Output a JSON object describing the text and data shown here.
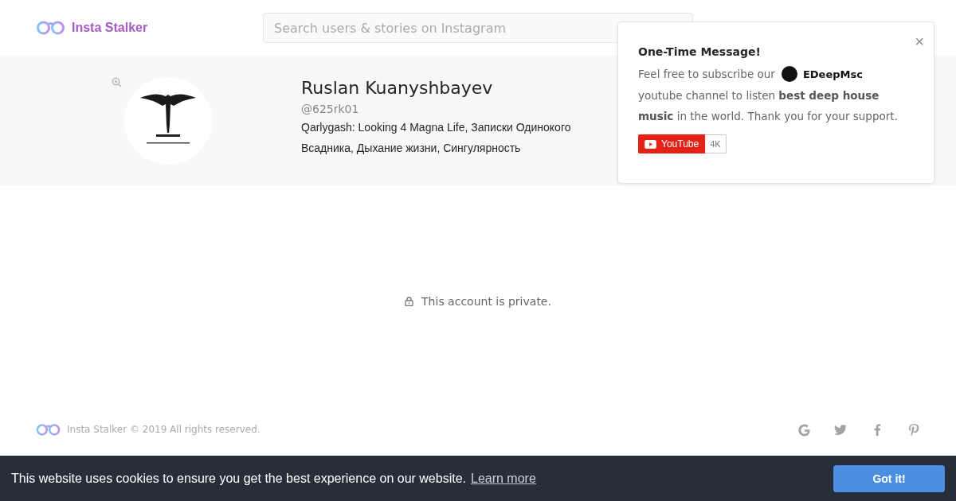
{
  "header": {
    "brand": "Insta Stalker",
    "search": {
      "placeholder": "Search users & stories on Instagram"
    }
  },
  "profile": {
    "name": "Ruslan Kuanyshbayev",
    "username": "@625rk01",
    "bio": "Qarlygash: Looking 4 Magna Life, Записки Одинокого Всадника, Дыхание жизни, Сингулярность"
  },
  "popup": {
    "title": "One-Time Message!",
    "close": "×",
    "text_before": "Feel free to subscribe our",
    "channel": "EDeepMsc",
    "text_after": "youtube channel to listen **best deep house music** in the world. Thank you for your support.",
    "youtube_button": "YouTube",
    "subscriber_count": "4K"
  },
  "content": {
    "private_message": "This account is private."
  },
  "footer": {
    "copyright": "Insta Stalker © 2019 All rights reserved.",
    "social": [
      {
        "kind": "google"
      },
      {
        "kind": "twitter"
      },
      {
        "kind": "facebook"
      },
      {
        "kind": "pinterest"
      }
    ]
  },
  "cookie_bar": {
    "message": "This website uses cookies to ensure you get the best experience on our website.",
    "link": "Learn more",
    "button": "Got it!"
  }
}
